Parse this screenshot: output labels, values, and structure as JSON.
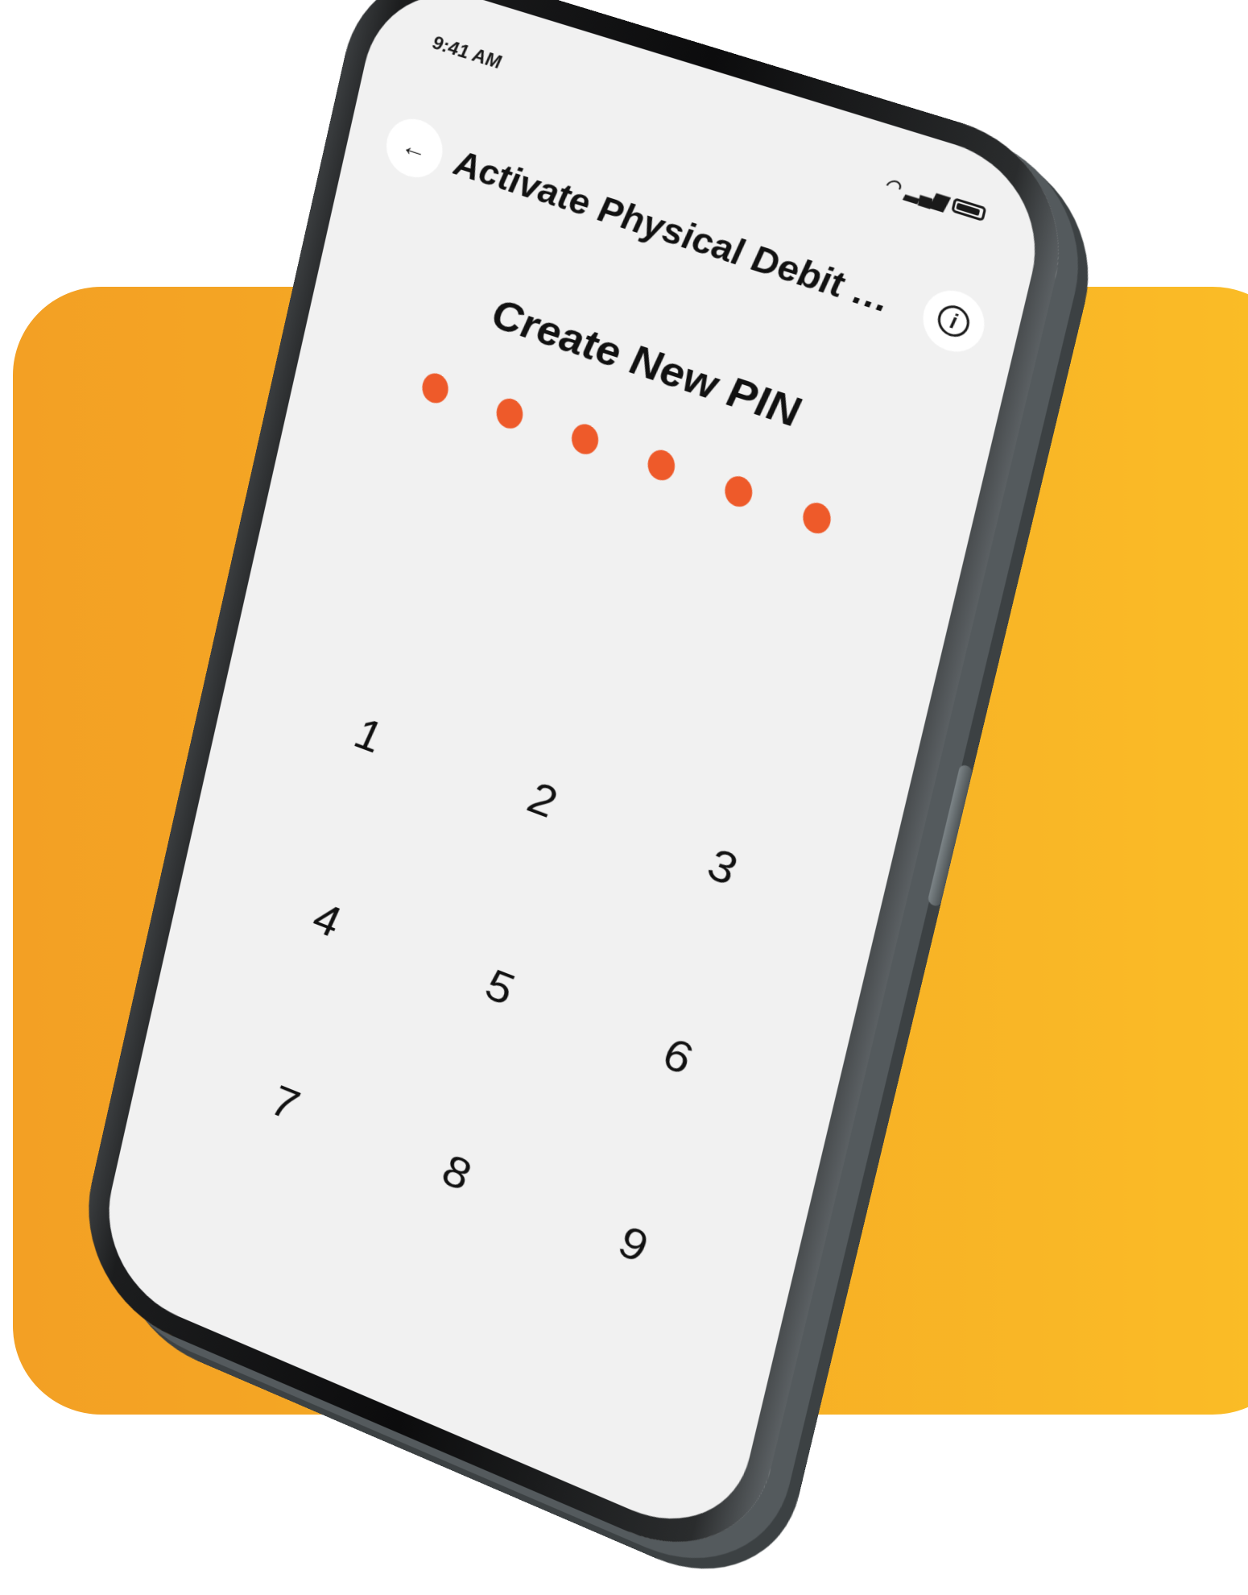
{
  "status_bar": {
    "time": "9:41 AM",
    "wifi_icon": "wifi-icon",
    "signal_icon": "signal-icon",
    "battery_icon": "battery-icon"
  },
  "header": {
    "title": "Activate Physical Debit Ca...",
    "back_icon": "back-arrow-icon",
    "info_icon": "info-icon"
  },
  "pin": {
    "title": "Create New PIN",
    "filled_count": 6,
    "total": 6,
    "dot_color": "#ee5a2a"
  },
  "keypad": {
    "keys": [
      "1",
      "2",
      "3",
      "4",
      "5",
      "6",
      "7",
      "8",
      "9"
    ]
  },
  "colors": {
    "background_orange": "#f3a024",
    "background_yellow": "#fbbd26",
    "screen": "#f1f1f1"
  }
}
